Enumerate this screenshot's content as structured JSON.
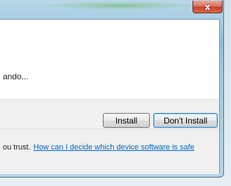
{
  "titlebar": {
    "close_glyph": "x"
  },
  "message": {
    "text": "ando..."
  },
  "buttons": {
    "install_label": "Install",
    "dont_install_label": "Don't Install"
  },
  "footer": {
    "text": "ou trust.",
    "link_text": "How can I decide which device software is safe"
  },
  "colors": {
    "link": "#0066cc",
    "close_button": "#c5432a",
    "default_button_border": "#3c7fb1"
  }
}
